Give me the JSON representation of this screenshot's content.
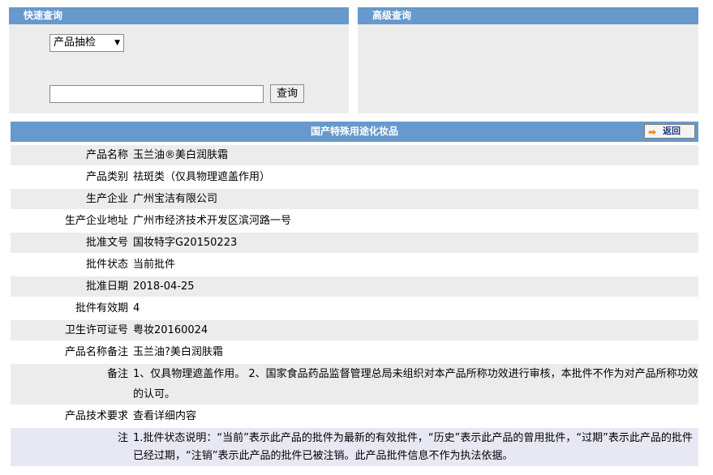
{
  "quick_search": {
    "title": "快速查询",
    "select_value": "产品抽检",
    "input_value": "",
    "button_label": "查询"
  },
  "advanced_search": {
    "title": "高级查询"
  },
  "detail": {
    "title": "国产特殊用途化妆品",
    "back_label": "返回",
    "rows": [
      {
        "label": "产品名称",
        "value": "玉兰油®美白润肤霜"
      },
      {
        "label": "产品类别",
        "value": "祛斑类（仅具物理遮盖作用）"
      },
      {
        "label": "生产企业",
        "value": "广州宝洁有限公司"
      },
      {
        "label": "生产企业地址",
        "value": "广州市经济技术开发区滨河路一号"
      },
      {
        "label": "批准文号",
        "value": "国妆特字G20150223"
      },
      {
        "label": "批件状态",
        "value": "当前批件"
      },
      {
        "label": "批准日期",
        "value": "2018-04-25"
      },
      {
        "label": "批件有效期",
        "value": "4"
      },
      {
        "label": "卫生许可证号",
        "value": "粤妆20160024"
      },
      {
        "label": "产品名称备注",
        "value": "玉兰油?美白润肤霜"
      },
      {
        "label": "备注",
        "value": "1、仅具物理遮盖作用。 2、国家食品药品监督管理总局未组织对本产品所称功效进行审核，本批件不作为对产品所称功效的认可。"
      },
      {
        "label": "产品技术要求",
        "value": "查看详细内容"
      },
      {
        "label": "注",
        "value": "1.批件状态说明：“当前”表示此产品的批件为最新的有效批件，“历史”表示此产品的曾用批件，“过期”表示此产品的批件已经过期，“注销”表示此产品的批件已被注销。此产品批件信息不作为执法依据。"
      }
    ]
  }
}
